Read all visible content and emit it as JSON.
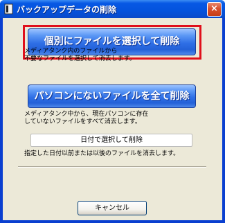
{
  "window": {
    "title": "バックアップデータの削除",
    "close_label": "×"
  },
  "buttons": {
    "delete_selected_files": "個別にファイルを選択して削除",
    "delete_files_not_on_pc": "パソコンにないファイルを全て削除",
    "delete_by_date": "日付で選択して削除",
    "cancel": "キャンセル"
  },
  "descriptions": {
    "delete_selected_files": "メディアタンク内のファイルから\n不要なファイルを選択して消去します。",
    "delete_files_not_on_pc": "メディアタンク中から、現在パソコンに存在\nしていないファイルをすべて消去します。",
    "delete_by_date": "指定した日付以前または以後のファイルを消去します。"
  },
  "colors": {
    "highlight_border": "#e0101b",
    "titlebar": "#0453dd",
    "dialog_background": "#ece9d8"
  },
  "icons": {
    "title_icon": "app-icon",
    "close": "close-icon"
  }
}
